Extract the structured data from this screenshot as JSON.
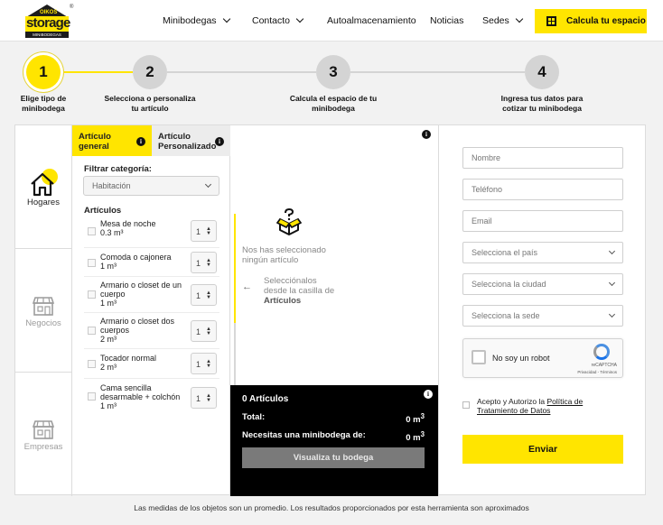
{
  "brand": {
    "top": "OIKOS",
    "name": "storage",
    "tagline": "MINIBODEGAS",
    "reg": "®"
  },
  "nav": {
    "items": [
      {
        "label": "Minibodegas"
      },
      {
        "label": "Contacto"
      },
      {
        "label": "Autoalmacenamiento"
      },
      {
        "label": "Noticias"
      },
      {
        "label": "Sedes"
      }
    ],
    "cta": "Calcula tu espacio"
  },
  "steps": [
    {
      "number": "1",
      "line1": "Elige tipo de",
      "line2": "minibodega",
      "active": true
    },
    {
      "number": "2",
      "line1": "Selecciona o personaliza",
      "line2": "tu artículo",
      "active": false
    },
    {
      "number": "3",
      "line1": "Calcula el espacio de tu",
      "line2": "minibodega",
      "active": false
    },
    {
      "number": "4",
      "line1": "Ingresa tus datos para",
      "line2": "cotizar tu minibodega",
      "active": false
    }
  ],
  "types": [
    {
      "label": "Hogares"
    },
    {
      "label": "Negocios"
    },
    {
      "label": "Empresas"
    }
  ],
  "tabs": {
    "general_l1": "Artículo",
    "general_l2": "general",
    "custom_l1": "Artículo",
    "custom_l2": "Personalizado",
    "info": "i"
  },
  "filter": {
    "label": "Filtrar categoría:",
    "value": "Habitación"
  },
  "articles": {
    "label": "Artículos",
    "items": [
      {
        "l1": "Mesa de noche",
        "l2": "0.3 m³",
        "qty": "1"
      },
      {
        "l1": "Comoda o cajonera",
        "l2": "1 m³",
        "qty": "1"
      },
      {
        "l1": "Armario o closet de un",
        "l2": "cuerpo",
        "l3": "1 m³",
        "qty": "1"
      },
      {
        "l1": "Armario o closet dos",
        "l2": "cuerpos",
        "l3": "2 m³",
        "qty": "1"
      },
      {
        "l1": "Tocador normal",
        "l2": "2 m³",
        "qty": "1"
      },
      {
        "l1": "Cama sencilla",
        "l2": "desarmable + colchón",
        "l3": "1 m³",
        "qty": "1"
      }
    ]
  },
  "empty": {
    "line1": "Nos has seleccionado",
    "line2": "ningún artículo",
    "hint1": "Selecciónalos",
    "hint2": "desde la casilla de",
    "hint3": "Artículos",
    "arrow": "←"
  },
  "summary": {
    "title": "0 Artículos",
    "total_label": "Total:",
    "total_value": "0 m",
    "need_label": "Necesitas una minibodega de:",
    "need_value": "0 m",
    "unit_sup": "3",
    "button": "Visualiza tu bodega"
  },
  "form": {
    "name_ph": "Nombre",
    "phone_ph": "Teléfono",
    "email_ph": "Email",
    "country": "Selecciona el país",
    "city": "Selecciona la ciudad",
    "site": "Selecciona la sede",
    "captcha": {
      "text": "No soy un robot",
      "brand": "reCAPTCHA",
      "links": "Privacidad - Términos"
    },
    "consent_prefix": "Acepto y Autorizo la ",
    "consent_link": "Política de Tratamiento de Datos",
    "submit": "Enviar"
  },
  "disclaimer": "Las medidas de los objetos son un promedio. Los resultados proporcionados por esta herramienta son aproximados"
}
